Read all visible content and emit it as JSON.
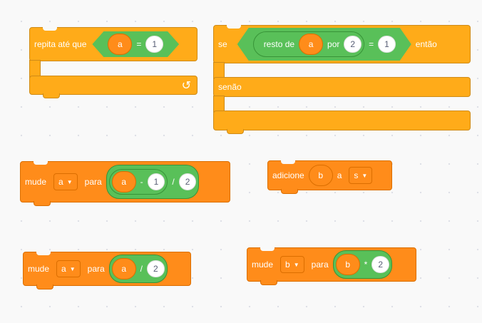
{
  "workspace": "blocks-editor",
  "colors": {
    "control": "#ffab19",
    "variable": "#ff8c1a",
    "operator": "#59c059",
    "background": "#f9f9f9"
  },
  "repeat_until": {
    "label": "repita até que",
    "var": "a",
    "op": "=",
    "value": "1",
    "loop_icon": "loop-arrow-icon"
  },
  "if_else": {
    "if_label": "se",
    "mod_label": "resto de",
    "var": "a",
    "by_label": "por",
    "divisor": "2",
    "eq_op": "=",
    "value": "1",
    "then_label": "então",
    "else_label": "senão"
  },
  "set_a_1": {
    "label": "mude",
    "var": "a",
    "to_label": "para",
    "inner_var": "a",
    "minus_op": "-",
    "minus_value": "1",
    "div_op": "/",
    "div_value": "2"
  },
  "add_to_list": {
    "label": "adicione",
    "item": "b",
    "to_label": "a",
    "list": "s"
  },
  "set_a_2": {
    "label": "mude",
    "var": "a",
    "to_label": "para",
    "inner_var": "a",
    "div_op": "/",
    "div_value": "2"
  },
  "set_b": {
    "label": "mude",
    "var": "b",
    "to_label": "para",
    "inner_var": "b",
    "mul_op": "*",
    "mul_value": "2"
  }
}
